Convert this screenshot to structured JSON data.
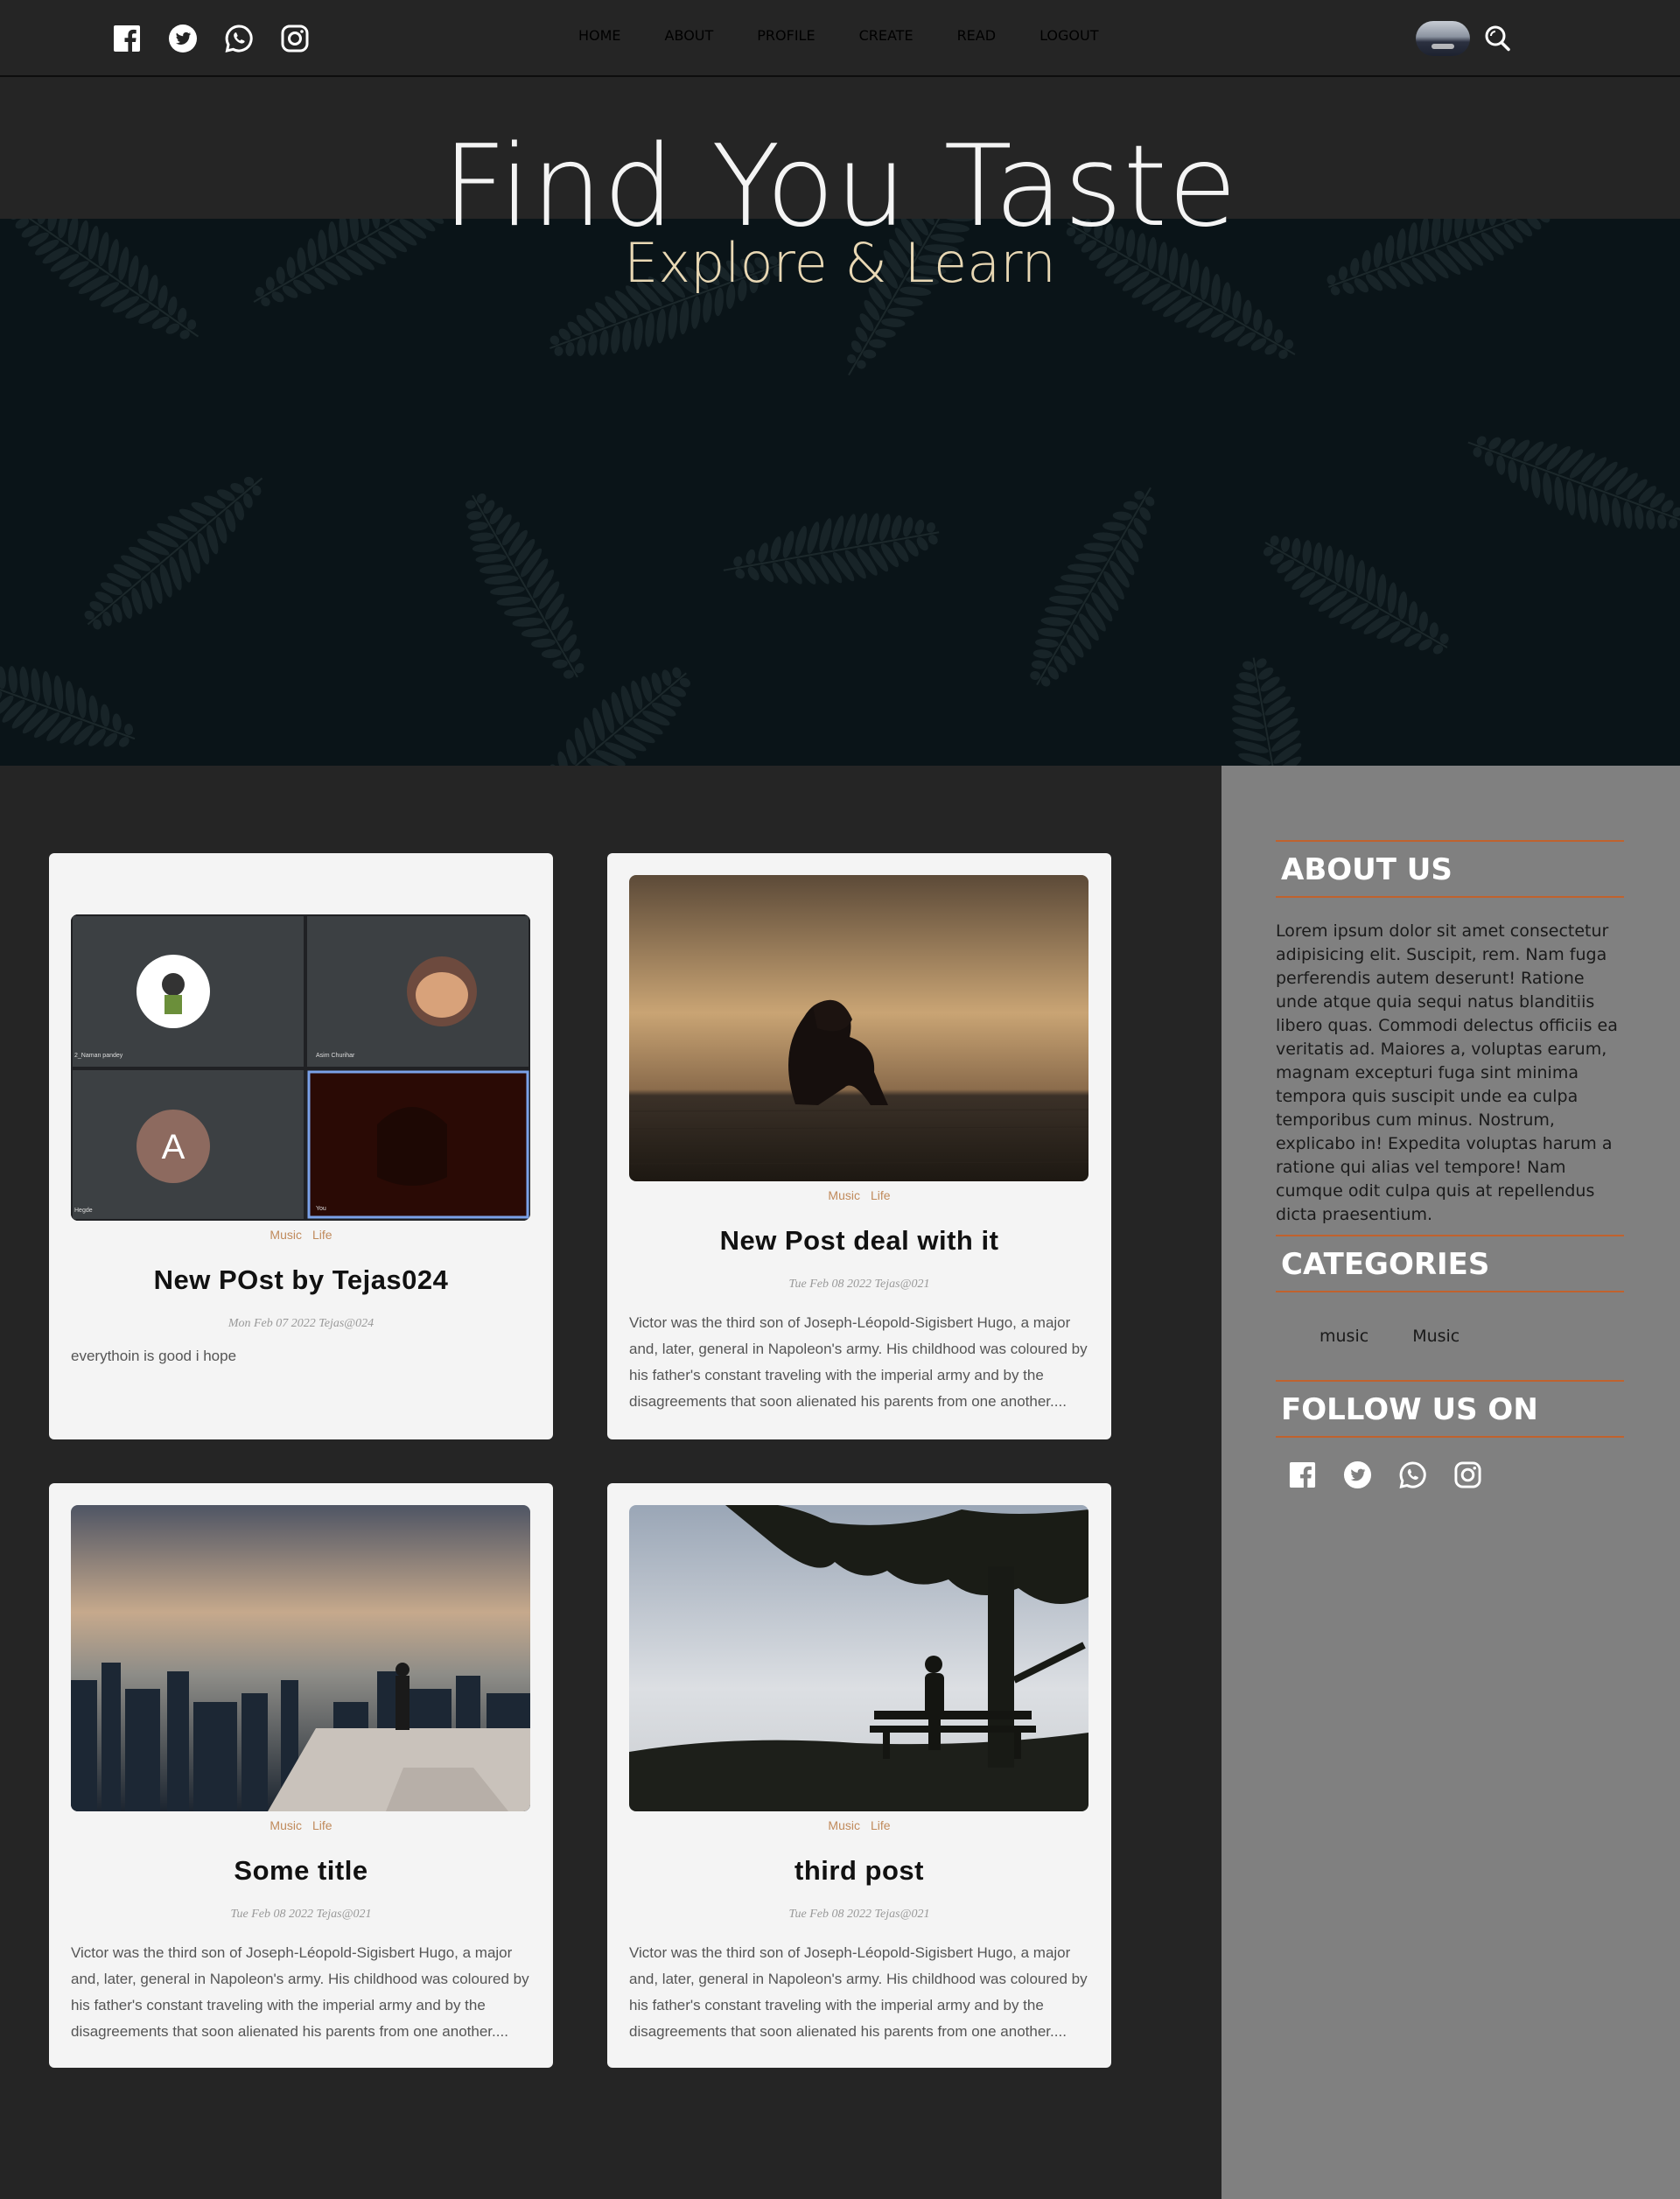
{
  "nav": {
    "social_icons": [
      "facebook-icon",
      "twitter-icon",
      "whatsapp-icon",
      "instagram-icon"
    ],
    "links": [
      "HOME",
      "ABOUT",
      "PROFILE",
      "CREATE",
      "READ",
      "LOGOUT"
    ]
  },
  "hero": {
    "title": "Find You Taste",
    "subtitle": "Explore & Learn"
  },
  "posts": [
    {
      "tags": [
        "Music",
        "Life"
      ],
      "title": "New POst by Tejas024",
      "meta": "Mon Feb 07 2022 Tejas@024",
      "body": "everythoin is good i hope",
      "video_call": {
        "participants": [
          "2_Naman pandey",
          "Asim Churihar",
          "Hegde",
          "You"
        ],
        "avatar_letter": "A"
      }
    },
    {
      "tags": [
        "Music",
        "Life"
      ],
      "title": "New Post deal with it",
      "meta": "Tue Feb 08 2022 Tejas@021",
      "body": "Victor was the third son of Joseph-Léopold-Sigisbert Hugo, a major and, later, general in Napoleon's army. His childhood was coloured by his father's constant traveling with the imperial army and by the disagreements that soon alienated his parents from one another...."
    },
    {
      "tags": [
        "Music",
        "Life"
      ],
      "title": "Some title",
      "meta": "Tue Feb 08 2022 Tejas@021",
      "body": "Victor was the third son of Joseph-Léopold-Sigisbert Hugo, a major and, later, general in Napoleon's army. His childhood was coloured by his father's constant traveling with the imperial army and by the disagreements that soon alienated his parents from one another...."
    },
    {
      "tags": [
        "Music",
        "Life"
      ],
      "title": "third post",
      "meta": "Tue Feb 08 2022 Tejas@021",
      "body": "Victor was the third son of Joseph-Léopold-Sigisbert Hugo, a major and, later, general in Napoleon's army. His childhood was coloured by his father's constant traveling with the imperial army and by the disagreements that soon alienated his parents from one another...."
    }
  ],
  "sidebar": {
    "about_heading": "ABOUT US",
    "about_text": "Lorem ipsum dolor sit amet consectetur adipisicing elit. Suscipit, rem. Nam fuga perferendis autem deserunt! Ratione unde atque quia sequi natus blanditiis libero quas. Commodi delectus officiis ea veritatis ad. Maiores a, voluptas earum, magnam excepturi fuga sint minima tempora quis suscipit unde ea culpa temporibus cum minus. Nostrum, explicabo in! Expedita voluptas harum a ratione qui alias vel tempore! Nam cumque odit culpa quis at repellendus dicta praesentium.",
    "categories_heading": "CATEGORIES",
    "categories": [
      "music",
      "Music"
    ],
    "follow_heading": "FOLLOW US ON"
  },
  "colors": {
    "accent": "#c0622e",
    "tag": "#c08a5b",
    "background": "#252525",
    "sidebar": "#808080",
    "card": "#f4f4f4"
  }
}
